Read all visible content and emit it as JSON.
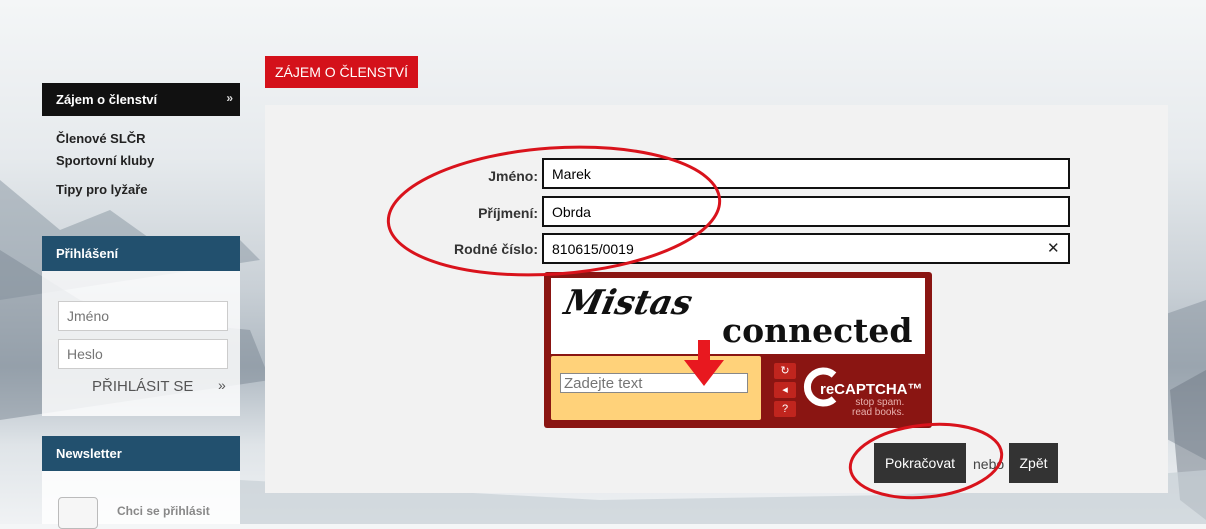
{
  "sidebar": {
    "active": "Zájem o členství",
    "items": [
      "Členové SLČR",
      "Sportovní kluby",
      "Tipy pro lyžaře"
    ],
    "login": {
      "title": "Přihlášení",
      "username_placeholder": "Jméno",
      "password_placeholder": "Heslo",
      "submit_label": "PŘIHLÁSIT SE"
    },
    "newsletter": {
      "title": "Newsletter",
      "subscribe_label": "Chci se přihlásit"
    }
  },
  "main": {
    "section_title": "ZÁJEM O ČLENSTVÍ",
    "form": {
      "first_name_label": "Jméno:",
      "first_name_value": "Marek",
      "last_name_label": "Příjmení:",
      "last_name_value": "Obrda",
      "birth_number_label": "Rodné číslo:",
      "birth_number_value": "810615/0019"
    },
    "captcha": {
      "word1": "Mistas",
      "word2": "connected",
      "input_placeholder": "Zadejte text",
      "logo": "reCAPTCHA™",
      "tagline1": "stop spam.",
      "tagline2": "read books."
    },
    "buttons": {
      "continue": "Pokračovat",
      "or": "nebo",
      "back": "Zpět"
    }
  },
  "colors": {
    "accent_red": "#d4111a",
    "sidebar_header": "#22506e",
    "annotation_red": "#d9131c"
  }
}
